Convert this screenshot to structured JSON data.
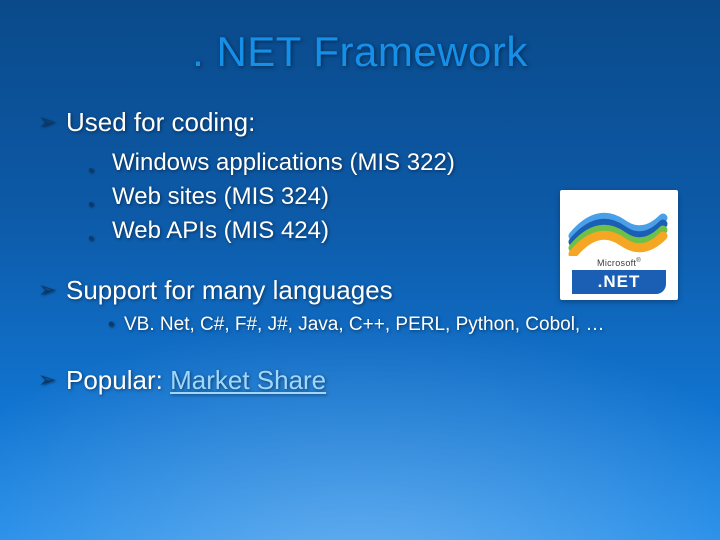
{
  "title": ". NET Framework",
  "bullets": {
    "b0": {
      "text": "Used for coding:",
      "subs": {
        "s0": "Windows applications (MIS 322)",
        "s1": "Web sites (MIS 324)",
        "s2": "Web APIs (MIS 424)"
      }
    },
    "b1": {
      "text": "Support for many languages",
      "subsubs": {
        "ss0": "VB. Net, C#, F#, J#, Java, C++, PERL, Python, Cobol, …"
      }
    },
    "b2": {
      "prefix": "Popular: ",
      "link": "Market Share"
    }
  },
  "logo": {
    "brand": "Microsoft",
    "reg": "®",
    "net": ".NET"
  }
}
